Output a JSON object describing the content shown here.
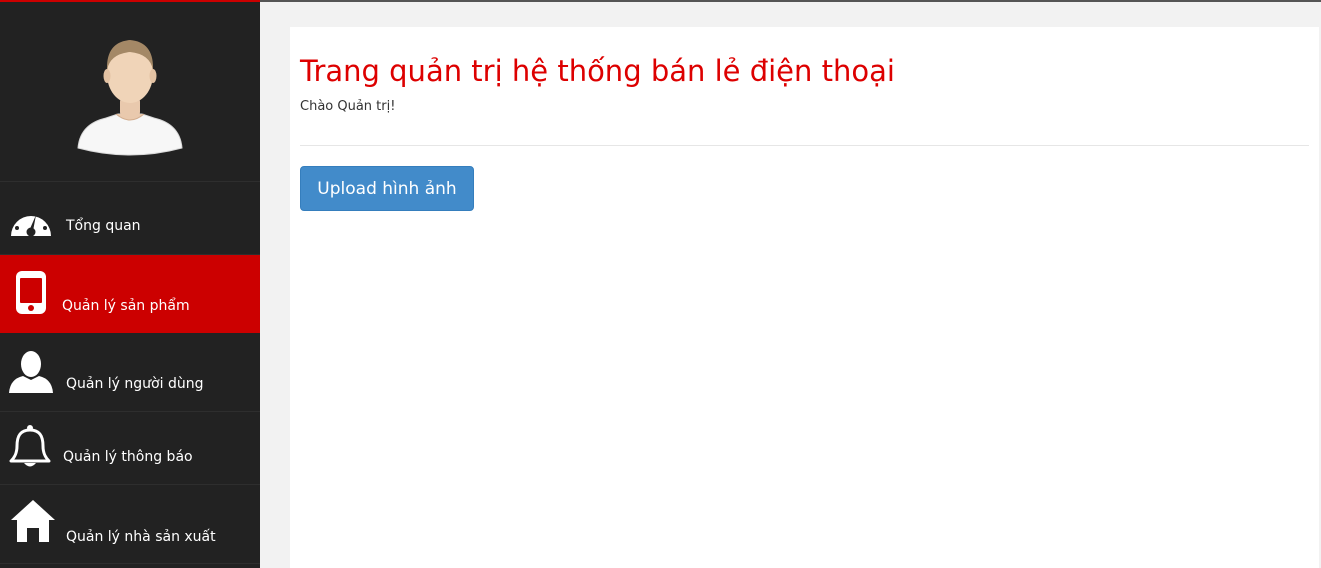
{
  "colors": {
    "accent": "#cc0000",
    "sidebar_bg": "#222222",
    "title": "#dd0000",
    "button": "#428bca"
  },
  "sidebar": {
    "avatar_icon": "user-avatar",
    "items": [
      {
        "label": "Tổng quan",
        "icon": "dashboard-gauge-icon",
        "active": false
      },
      {
        "label": "Quản lý sản phẩm",
        "icon": "mobile-phone-icon",
        "active": true
      },
      {
        "label": "Quản lý người dùng",
        "icon": "user-icon",
        "active": false
      },
      {
        "label": "Quản lý thông báo",
        "icon": "bell-icon",
        "active": false
      },
      {
        "label": "Quản lý nhà sản xuất",
        "icon": "home-icon",
        "active": false
      }
    ]
  },
  "main": {
    "title": "Trang quản trị hệ thống bán lẻ điện thoại",
    "greeting": "Chào Quản trị!",
    "upload_label": "Upload hình ảnh"
  }
}
